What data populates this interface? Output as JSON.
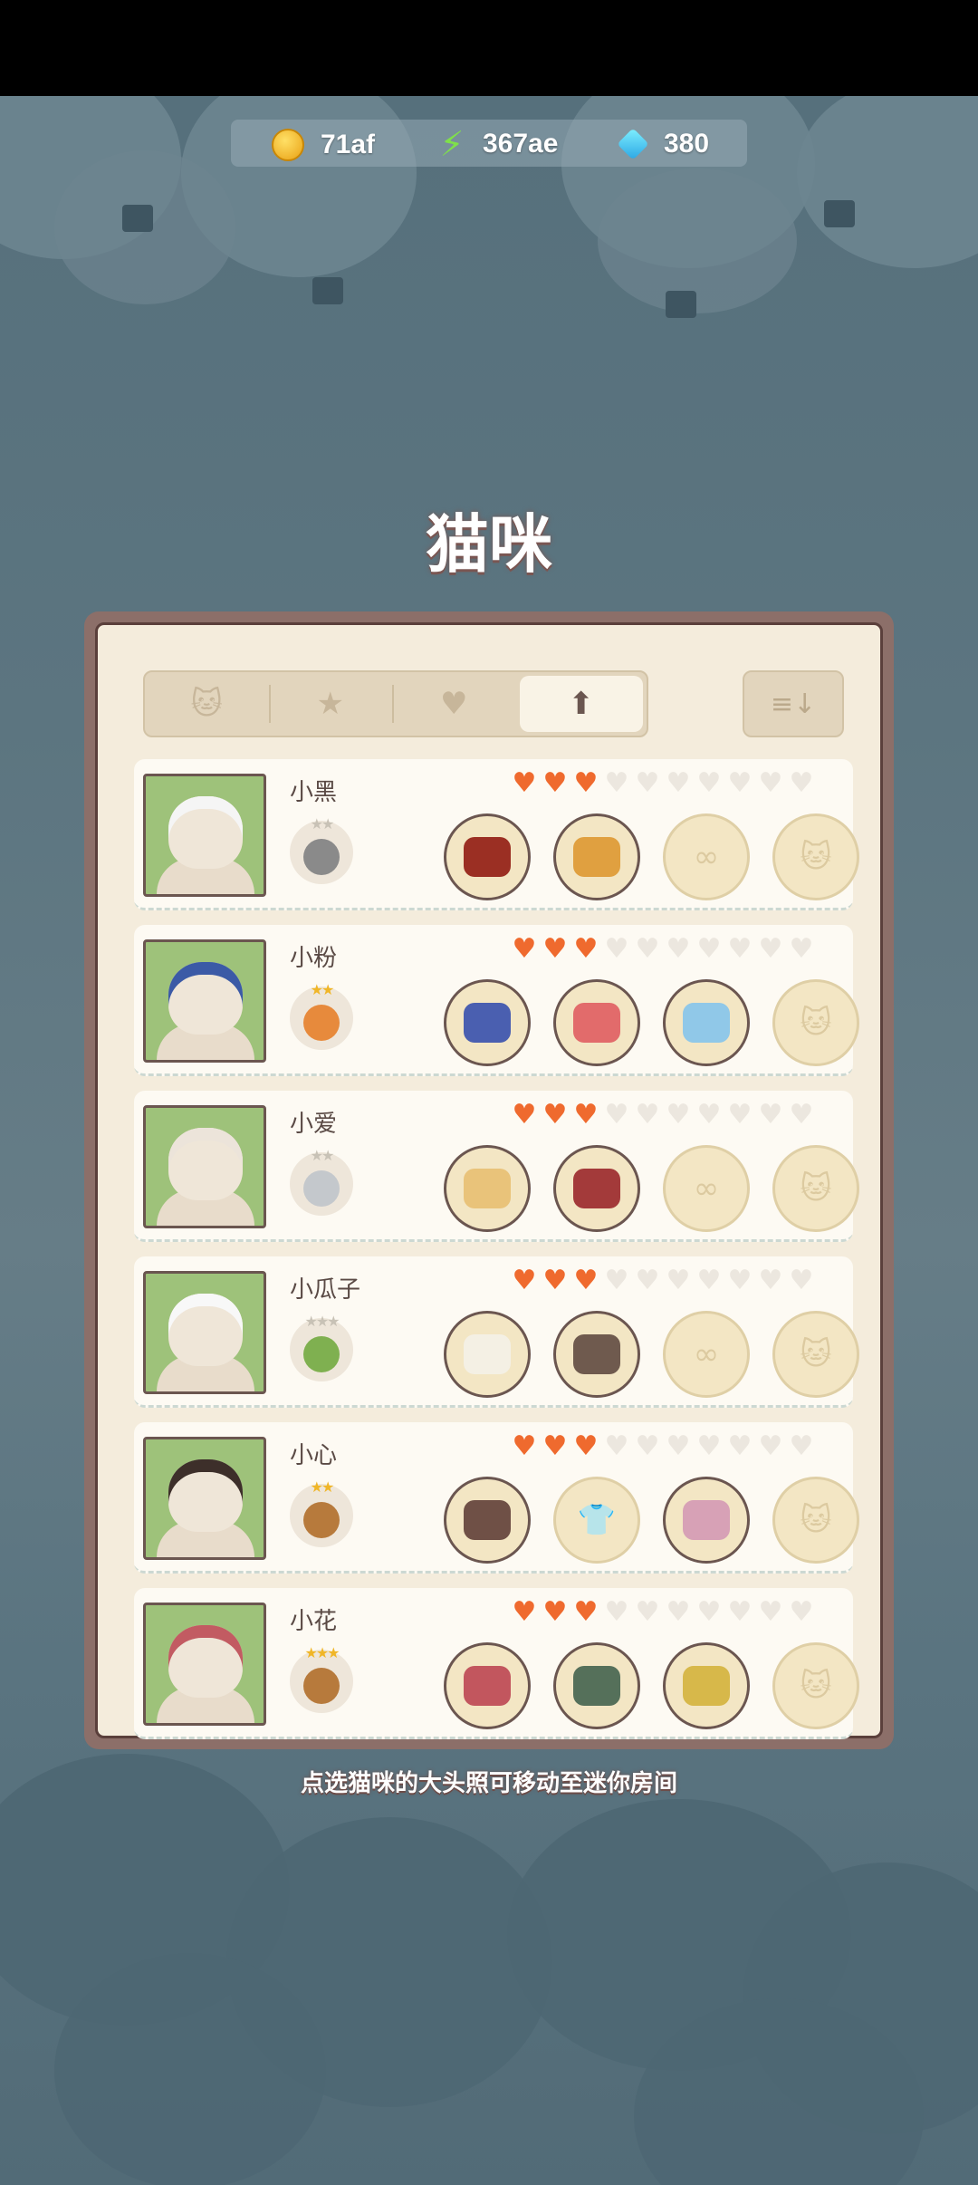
{
  "currency": {
    "coins": {
      "icon": "coin-icon",
      "value": "71af"
    },
    "energy": {
      "icon": "lightning-icon",
      "value": "367ae"
    },
    "gems": {
      "icon": "gem-icon",
      "value": "380"
    }
  },
  "title": "猫咪",
  "tabs": [
    {
      "icon": "cat-head-icon",
      "glyph": "🐱"
    },
    {
      "icon": "star-icon",
      "glyph": "★"
    },
    {
      "icon": "heart-icon",
      "glyph": "♥"
    },
    {
      "icon": "arrow-up-icon",
      "glyph": "⬆"
    }
  ],
  "sort": {
    "icon": "sort-icon",
    "glyph": "≡↓"
  },
  "cats": [
    {
      "name": "小黑",
      "hearts": 3,
      "max_hearts": 10,
      "badge_stars": 2,
      "badge_gold": false,
      "badge_color": "#8a8a8a",
      "portrait_color": "#f5f5f5",
      "items": [
        "#9b2f23",
        "#e0a040",
        "empty-glasses",
        "empty-cat"
      ]
    },
    {
      "name": "小粉",
      "hearts": 3,
      "max_hearts": 10,
      "badge_stars": 2,
      "badge_gold": true,
      "badge_color": "#e78a3c",
      "portrait_color": "#3b5aa6",
      "items": [
        "#4a5fb0",
        "#e26b6b",
        "#90c8e8",
        "empty-cat"
      ]
    },
    {
      "name": "小爱",
      "hearts": 3,
      "max_hearts": 10,
      "badge_stars": 2,
      "badge_gold": false,
      "badge_color": "#c4c8cc",
      "portrait_color": "#ece4da",
      "items": [
        "#e9c37a",
        "#a33a3a",
        "empty-glasses",
        "empty-cat"
      ]
    },
    {
      "name": "小瓜子",
      "hearts": 3,
      "max_hearts": 10,
      "badge_stars": 3,
      "badge_gold": false,
      "badge_color": "#7fb050",
      "portrait_color": "#f8f8f8",
      "items": [
        "#f4f0e4",
        "#6f5a4e",
        "empty-glasses",
        "empty-cat"
      ]
    },
    {
      "name": "小心",
      "hearts": 3,
      "max_hearts": 10,
      "badge_stars": 2,
      "badge_gold": true,
      "badge_color": "#b77a3c",
      "portrait_color": "#3d2f2a",
      "items": [
        "#6f5046",
        "empty-shirt",
        "#d7a1b6",
        "empty-cat"
      ]
    },
    {
      "name": "小花",
      "hearts": 3,
      "max_hearts": 10,
      "badge_stars": 3,
      "badge_gold": true,
      "badge_color": "#b77a3c",
      "portrait_color": "#c25b62",
      "items": [
        "#c2565e",
        "#55705a",
        "#d7b84a",
        "empty-cat"
      ]
    }
  ],
  "hint": "点选猫咪的大头照可移动至迷你房间"
}
